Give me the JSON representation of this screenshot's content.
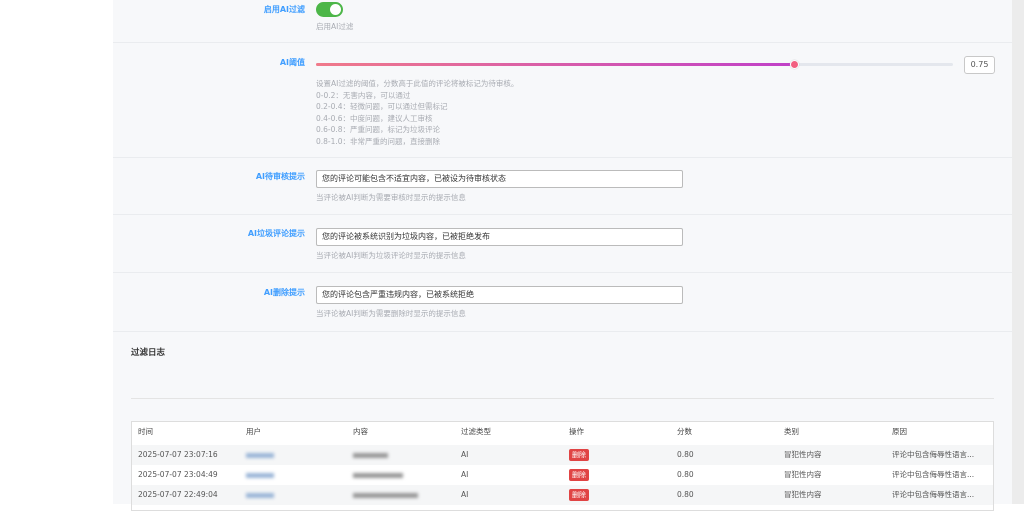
{
  "settings": {
    "enable": {
      "label": "启用AI过滤",
      "help": "启用AI过滤",
      "on": true
    },
    "threshold": {
      "label": "AI阈值",
      "value": "0.75",
      "fraction": 0.75,
      "help": [
        "设置AI过滤的阈值，分数高于此值的评论将被标记为待审核。",
        "0-0.2：无害内容，可以通过",
        "0.2-0.4：轻微问题，可以通过但需标记",
        "0.4-0.6：中度问题，建议人工审核",
        "0.6-0.8：严重问题，标记为垃圾评论",
        "0.8-1.0：非常严重的问题，直接删除"
      ]
    },
    "pending": {
      "label": "AI待审核提示",
      "value": "您的评论可能包含不适宜内容，已被设为待审核状态",
      "help": "当评论被AI判断为需要审核时显示的提示信息"
    },
    "spam": {
      "label": "AI垃圾评论提示",
      "value": "您的评论被系统识别为垃圾内容，已被拒绝发布",
      "help": "当评论被AI判断为垃圾评论时显示的提示信息"
    },
    "delete": {
      "label": "AI删除提示",
      "value": "您的评论包含严重违规内容，已被系统拒绝",
      "help": "当评论被AI判断为需要删除时显示的提示信息"
    }
  },
  "log": {
    "title": "过滤日志",
    "columns": [
      "时间",
      "用户",
      "内容",
      "过滤类型",
      "操作",
      "分数",
      "类别",
      "原因"
    ],
    "rows": [
      {
        "time": "2025-07-07 23:07:16",
        "type": "AI",
        "action": "删除",
        "score": "0.80",
        "category": "冒犯性内容",
        "reason": "评论中包含侮辱性语言..."
      },
      {
        "time": "2025-07-07 23:04:49",
        "type": "AI",
        "action": "删除",
        "score": "0.80",
        "category": "冒犯性内容",
        "reason": "评论中包含侮辱性语言..."
      },
      {
        "time": "2025-07-07 22:49:04",
        "type": "AI",
        "action": "删除",
        "score": "0.80",
        "category": "冒犯性内容",
        "reason": "评论中包含侮辱性语言..."
      }
    ]
  },
  "colors": {
    "accent": "#409eff",
    "toggle_on": "#4cb648",
    "danger": "#e04444"
  }
}
